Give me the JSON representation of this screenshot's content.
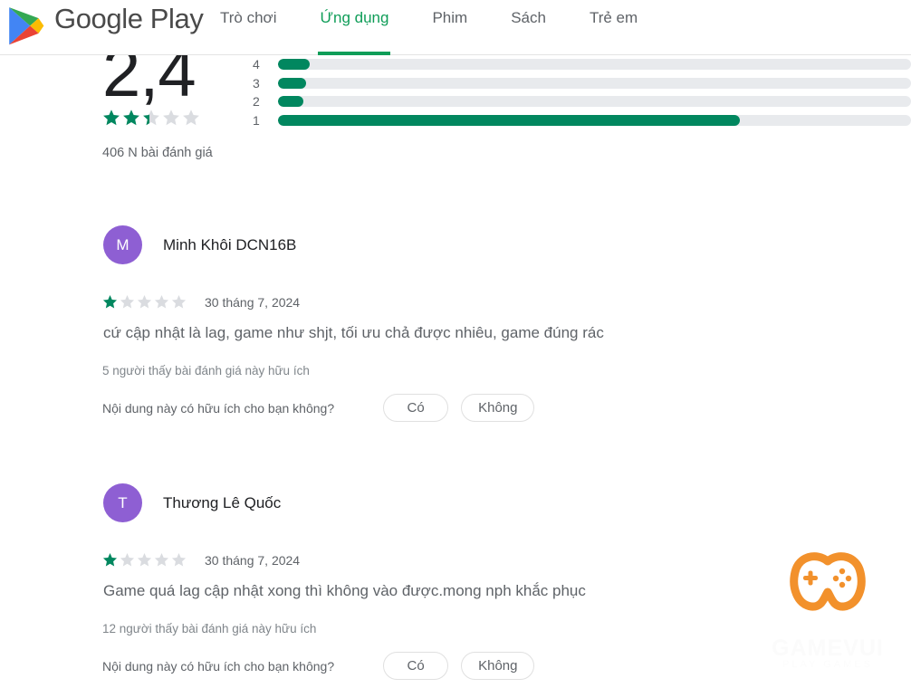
{
  "header": {
    "brand": "Google Play",
    "logo_icon": "google-play-triangle-icon",
    "nav": [
      {
        "label": "Trò chơi",
        "active": false
      },
      {
        "label": "Ứng dụng",
        "active": true
      },
      {
        "label": "Phim",
        "active": false
      },
      {
        "label": "Sách",
        "active": false
      },
      {
        "label": "Trẻ em",
        "active": false
      }
    ]
  },
  "rating_summary": {
    "score": "2,4",
    "stars_filled": 2.4,
    "review_count_text": "406 N bài đánh giá",
    "bars": [
      {
        "label": "4",
        "percent": 5
      },
      {
        "label": "3",
        "percent": 4.5
      },
      {
        "label": "2",
        "percent": 4
      },
      {
        "label": "1",
        "percent": 73
      }
    ]
  },
  "reviews": [
    {
      "avatar_letter": "M",
      "avatar_color": "#8e5fd3",
      "name": "Minh Khôi DCN16B",
      "stars": 1,
      "date": "30 tháng 7, 2024",
      "body": "cứ cập nhật là lag, game như shjt, tối ưu chả được nhiêu, game đúng rác",
      "helpful": "5 người thấy bài đánh giá này hữu ích",
      "ask": "Nội dung này có hữu ích cho bạn không?",
      "yes_label": "Có",
      "no_label": "Không"
    },
    {
      "avatar_letter": "T",
      "avatar_color": "#8e5fd3",
      "name": "Thương Lê Quốc",
      "stars": 1,
      "date": "30 tháng 7, 2024",
      "body": "Game quá lag cập nhật xong thì không vào được.mong nph khắc phục",
      "helpful": "12 người thấy bài đánh giá này hữu ích",
      "ask": "Nội dung này có hữu ích cho bạn không?",
      "yes_label": "Có",
      "no_label": "Không"
    }
  ],
  "watermark": {
    "icon": "gamepad-icon",
    "title": "GAMEVUI",
    "subtitle": "PLAY GAMES",
    "color": "#f2912c"
  },
  "colors": {
    "green": "#01875f",
    "nav_active": "#0f9d58",
    "track": "#e8eaed",
    "text_primary": "#202124",
    "text_secondary": "#5f6368"
  }
}
